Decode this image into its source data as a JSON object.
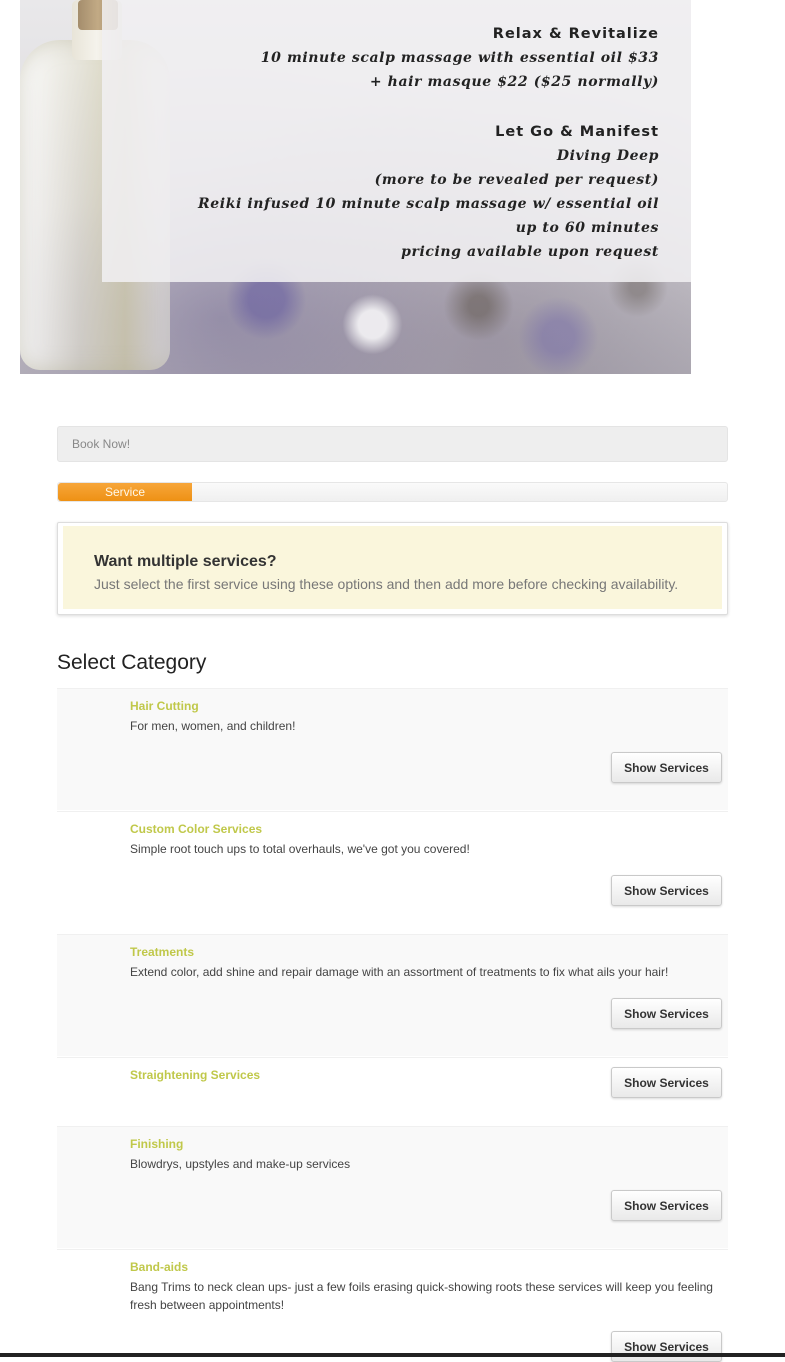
{
  "banner": {
    "heading1": "Relax & Revitalize",
    "line1": "10 minute scalp massage with essential oil $33",
    "line2": "+ hair masque $22 ($25 normally)",
    "heading2": "Let Go & Manifest",
    "line3": "Diving Deep",
    "line4": "(more to be revealed per request)",
    "line5": "Reiki infused 10 minute scalp massage w/ essential oil",
    "line6": "up to 60 minutes",
    "line7": "pricing available upon request"
  },
  "booking": {
    "title": "Book Now!",
    "progress_label": "Service"
  },
  "notice": {
    "title": "Want multiple services?",
    "text": "Just select the first service using these options and then add more before checking availability."
  },
  "section_title": "Select Category",
  "button_label": "Show Services",
  "categories": [
    {
      "name": "Hair Cutting",
      "description": "For men, women, and children!"
    },
    {
      "name": "Custom Color Services",
      "description": "Simple root touch ups to total overhauls, we've got you covered!"
    },
    {
      "name": "Treatments",
      "description": "Extend color, add shine and repair damage with an assortment of treatments to fix what ails your hair!"
    },
    {
      "name": "Straightening Services",
      "description": ""
    },
    {
      "name": "Finishing",
      "description": "Blowdrys, upstyles and make-up services"
    },
    {
      "name": "Band-aids",
      "description": "Bang Trims to neck clean ups- just a few foils erasing quick-showing roots these services will keep you feeling fresh between appointments!"
    }
  ]
}
